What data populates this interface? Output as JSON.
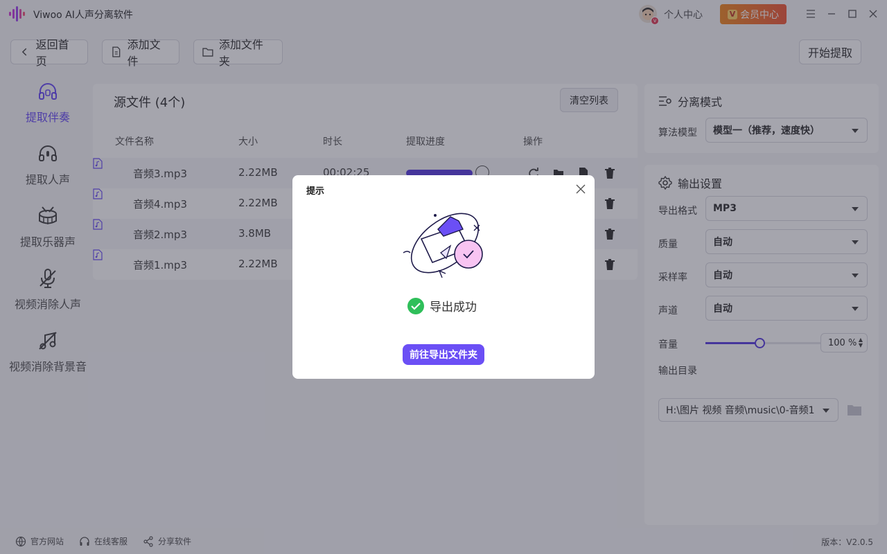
{
  "app": {
    "title": "Viwoo AI人声分离软件",
    "personal_center": "个人中心",
    "vip_center": "会员中心",
    "vip_badge": "V"
  },
  "toolbar": {
    "back": "返回首页",
    "add_file": "添加文件",
    "add_folder": "添加文件夹",
    "start": "开始提取"
  },
  "sidebar": {
    "items": [
      {
        "label": "提取伴奏",
        "icon": "headphones-icon",
        "active": true
      },
      {
        "label": "提取人声",
        "icon": "headset-mic-icon",
        "active": false
      },
      {
        "label": "提取乐器声",
        "icon": "drum-icon",
        "active": false
      },
      {
        "label": "视频消除人声",
        "icon": "mic-off-icon",
        "active": false
      },
      {
        "label": "视频消除背景音",
        "icon": "music-off-icon",
        "active": false
      }
    ]
  },
  "source": {
    "title": "源文件 (4个)",
    "clear": "清空列表",
    "columns": [
      "文件名称",
      "大小",
      "时长",
      "提取进度",
      "操作"
    ],
    "rows": [
      {
        "name": "音频3.mp3",
        "size": "2.22MB",
        "duration": "00:02:25",
        "progress": 100
      },
      {
        "name": "音频4.mp3",
        "size": "2.22MB",
        "duration": "",
        "progress": null
      },
      {
        "name": "音频2.mp3",
        "size": "3.8MB",
        "duration": "",
        "progress": null
      },
      {
        "name": "音频1.mp3",
        "size": "2.22MB",
        "duration": "",
        "progress": null
      }
    ]
  },
  "settings": {
    "mode_title": "分离模式",
    "model_label": "算法模型",
    "model_value": "模型一（推荐，速度快）",
    "output_title": "输出设置",
    "format_label": "导出格式",
    "format_value": "MP3",
    "quality_label": "质量",
    "quality_value": "自动",
    "samplerate_label": "采样率",
    "samplerate_value": "自动",
    "channel_label": "声道",
    "channel_value": "自动",
    "volume_label": "音量",
    "volume_value": "100 %",
    "volume_level": 0.47,
    "dir_label": "输出目录",
    "dir_value": "H:\\图片 视频 音频\\music\\0-音频1"
  },
  "footer": {
    "website": "官方网站",
    "support": "在线客服",
    "share": "分享软件",
    "version": "版本：V2.0.5"
  },
  "dialog": {
    "title": "提示",
    "message": "导出成功",
    "button": "前往导出文件夹"
  },
  "colors": {
    "accent": "#6b4ff5",
    "success": "#2fbf5a",
    "vip": "#f05a3a"
  }
}
